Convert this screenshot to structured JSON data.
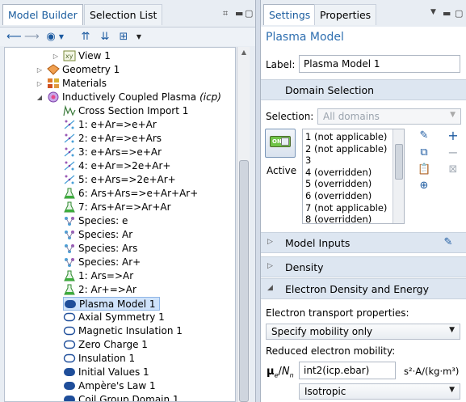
{
  "left": {
    "tabs": [
      "Model Builder",
      "Selection List"
    ],
    "tree": [
      {
        "label": "View 1",
        "icon": "view-icon",
        "depth": 4,
        "expander": "▷"
      },
      {
        "label": "Geometry 1",
        "icon": "geometry-icon",
        "depth": 3,
        "expander": "▷"
      },
      {
        "label": "Materials",
        "icon": "materials-icon",
        "depth": 3,
        "expander": "▷"
      },
      {
        "label": "Inductively Coupled Plasma",
        "label_italic": "(icp)",
        "icon": "icp-physics-icon",
        "depth": 3,
        "expander": "◢"
      },
      {
        "label": "Cross Section Import 1",
        "icon": "cross-section-icon",
        "depth": 4
      },
      {
        "label": "1: e+Ar=>e+Ar",
        "icon": "reaction-icon",
        "depth": 4
      },
      {
        "label": "2: e+Ar=>e+Ars",
        "icon": "reaction-icon",
        "depth": 4
      },
      {
        "label": "3: e+Ars=>e+Ar",
        "icon": "reaction-icon",
        "depth": 4
      },
      {
        "label": "4: e+Ar=>2e+Ar+",
        "icon": "reaction-icon",
        "depth": 4
      },
      {
        "label": "5: e+Ars=>2e+Ar+",
        "icon": "reaction-icon",
        "depth": 4
      },
      {
        "label": "6: Ars+Ars=>e+Ar+Ar+",
        "icon": "flask-icon",
        "depth": 4
      },
      {
        "label": "7: Ars+Ar=>Ar+Ar",
        "icon": "flask-icon",
        "depth": 4
      },
      {
        "label": "Species: e",
        "icon": "species-icon",
        "depth": 4
      },
      {
        "label": "Species: Ar",
        "icon": "species-icon",
        "depth": 4
      },
      {
        "label": "Species: Ars",
        "icon": "species-icon",
        "depth": 4
      },
      {
        "label": "Species: Ar+",
        "icon": "species-icon",
        "depth": 4
      },
      {
        "label": "1: Ars=>Ar",
        "icon": "flask-icon",
        "depth": 4
      },
      {
        "label": "2: Ar+=>Ar",
        "icon": "flask-icon",
        "depth": 4
      },
      {
        "label": "Plasma Model 1",
        "icon": "domain-node-icon",
        "depth": 4,
        "selected": true
      },
      {
        "label": "Axial Symmetry 1",
        "icon": "boundary-node-icon",
        "depth": 4
      },
      {
        "label": "Magnetic Insulation 1",
        "icon": "boundary-node-icon",
        "depth": 4
      },
      {
        "label": "Zero Charge 1",
        "icon": "boundary-node-icon",
        "depth": 4
      },
      {
        "label": "Insulation 1",
        "icon": "boundary-node-icon",
        "depth": 4
      },
      {
        "label": "Initial Values 1",
        "icon": "domain-node-icon",
        "depth": 4
      },
      {
        "label": "Ampère's Law 1",
        "icon": "domain-node-icon",
        "depth": 4
      },
      {
        "label": "Coil Group Domain 1",
        "icon": "domain-node-icon",
        "depth": 4
      }
    ]
  },
  "right": {
    "tabs": [
      "Settings",
      "Properties"
    ],
    "title": "Plasma Model",
    "label_caption": "Label:",
    "label_value": "Plasma Model 1",
    "domain_selection": {
      "heading": "Domain Selection",
      "selection_caption": "Selection:",
      "selection_value": "All domains",
      "active_caption": "Active",
      "toggle_text": "ON",
      "items": [
        "1 (not applicable)",
        "2 (not applicable)",
        "3",
        "4 (overridden)",
        "5 (overridden)",
        "6 (overridden)",
        "7 (not applicable)",
        "8 (overridden)"
      ]
    },
    "sections": {
      "model_inputs": "Model Inputs",
      "density": "Density",
      "electron": "Electron Density and Energy"
    },
    "electron": {
      "transport_caption": "Electron transport properties:",
      "transport_value": "Specify mobility only",
      "mobility_caption": "Reduced electron mobility:",
      "symbol_mu": "μ",
      "symbol_sub_e": "e",
      "symbol_slash": "/",
      "symbol_N": "N",
      "symbol_sub_n": "n",
      "mobility_value": "int2(icp.ebar)",
      "units": "s²·A/(kg·m³)",
      "isotropic_value": "Isotropic"
    }
  },
  "colors": {
    "accent": "#2f6fb0",
    "section_bg": "#dde6f1",
    "selected_row": "#cfe3fb",
    "toggle_green": "#6fc447"
  }
}
